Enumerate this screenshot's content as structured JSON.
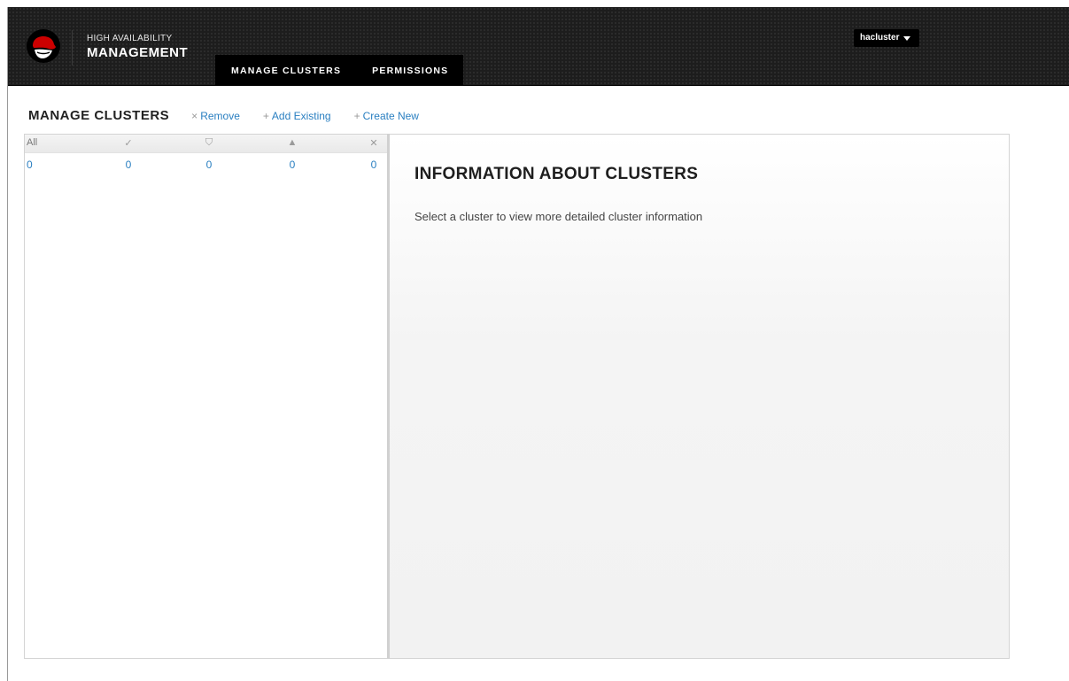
{
  "brand": {
    "line1": "HIGH AVAILABILITY",
    "line2": "MANAGEMENT",
    "logo_icon": "red-hat-shadowman-icon"
  },
  "tabs": [
    {
      "label": "MANAGE CLUSTERS",
      "active": true
    },
    {
      "label": "PERMISSIONS",
      "active": false
    }
  ],
  "user": {
    "name": "hacluster",
    "icon": "caret-down-icon"
  },
  "toolbar": {
    "title": "MANAGE CLUSTERS",
    "remove": {
      "symbol": "×",
      "label": "Remove"
    },
    "add_existing": {
      "symbol": "+",
      "label": "Add Existing"
    },
    "create_new": {
      "symbol": "+",
      "label": "Create New"
    }
  },
  "stats": {
    "headers": [
      {
        "name": "all",
        "label": "All"
      },
      {
        "name": "ok",
        "label": "✓",
        "icon": "check-icon"
      },
      {
        "name": "shield",
        "label": "⛉",
        "icon": "shield-icon"
      },
      {
        "name": "warning",
        "label": "▲",
        "icon": "warning-icon"
      },
      {
        "name": "error",
        "label": "✕",
        "icon": "x-icon"
      }
    ],
    "values": [
      "0",
      "0",
      "0",
      "0",
      "0"
    ]
  },
  "info": {
    "title": "INFORMATION ABOUT CLUSTERS",
    "text": "Select a cluster to view more detailed cluster information"
  },
  "colors": {
    "header_bg": "#1d1d1d",
    "link": "#2a7fc1",
    "brand_red": "#cc0000"
  }
}
